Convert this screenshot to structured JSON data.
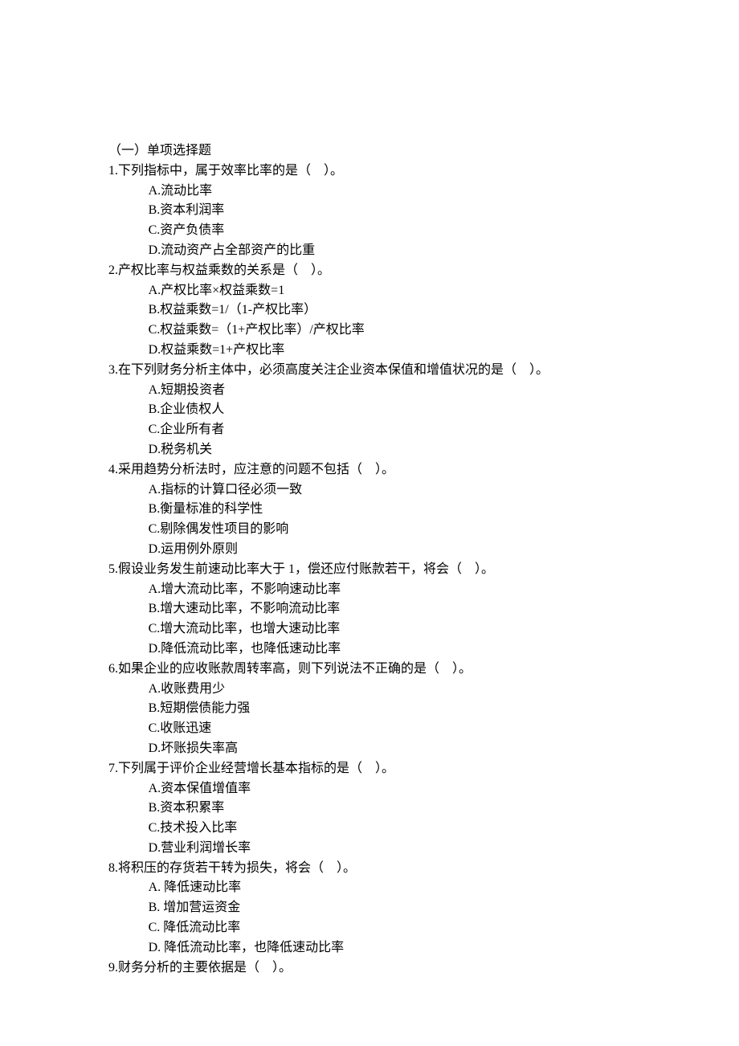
{
  "section_title": "（一）单项选择题",
  "questions": [
    {
      "num": "1",
      "stem": "下列指标中，属于效率比率的是（　）。",
      "opts": [
        "A.流动比率",
        "B.资本利润率",
        "C.资产负债率",
        "D.流动资产占全部资产的比重"
      ]
    },
    {
      "num": "2",
      "stem": "产权比率与权益乘数的关系是（　）。",
      "opts": [
        "A.产权比率×权益乘数=1",
        "B.权益乘数=1/（1-产权比率）",
        "C.权益乘数=（1+产权比率）/产权比率",
        "D.权益乘数=1+产权比率"
      ]
    },
    {
      "num": "3",
      "stem": "在下列财务分析主体中，必须高度关注企业资本保值和增值状况的是（　）。",
      "opts": [
        "A.短期投资者",
        "B.企业债权人",
        "C.企业所有者",
        "D.税务机关"
      ]
    },
    {
      "num": "4",
      "stem": "采用趋势分析法时，应注意的问题不包括（　）。",
      "opts": [
        "A.指标的计算口径必须一致",
        "B.衡量标准的科学性",
        "C.剔除偶发性项目的影响",
        "D.运用例外原则"
      ]
    },
    {
      "num": "5",
      "stem": "假设业务发生前速动比率大于 1，偿还应付账款若干，将会（　）。",
      "opts": [
        "A.增大流动比率，不影响速动比率",
        "B.增大速动比率，不影响流动比率",
        "C.增大流动比率，也增大速动比率",
        "D.降低流动比率，也降低速动比率"
      ]
    },
    {
      "num": "6",
      "stem": "如果企业的应收账款周转率高，则下列说法不正确的是（　）。",
      "opts": [
        "A.收账费用少",
        "B.短期偿债能力强",
        "C.收账迅速",
        "D.坏账损失率高"
      ]
    },
    {
      "num": "7",
      "stem": "下列属于评价企业经营增长基本指标的是（　）。",
      "opts": [
        "A.资本保值增值率",
        "B.资本积累率",
        "C.技术投入比率",
        "D.营业利润增长率"
      ]
    },
    {
      "num": "8",
      "stem": "将积压的存货若干转为损失，将会（　）。",
      "opts": [
        "A. 降低速动比率",
        "B. 增加营运资金",
        "C. 降低流动比率",
        "D. 降低流动比率，也降低速动比率"
      ]
    },
    {
      "num": "9",
      "stem": "财务分析的主要依据是（　）。",
      "opts": []
    }
  ]
}
